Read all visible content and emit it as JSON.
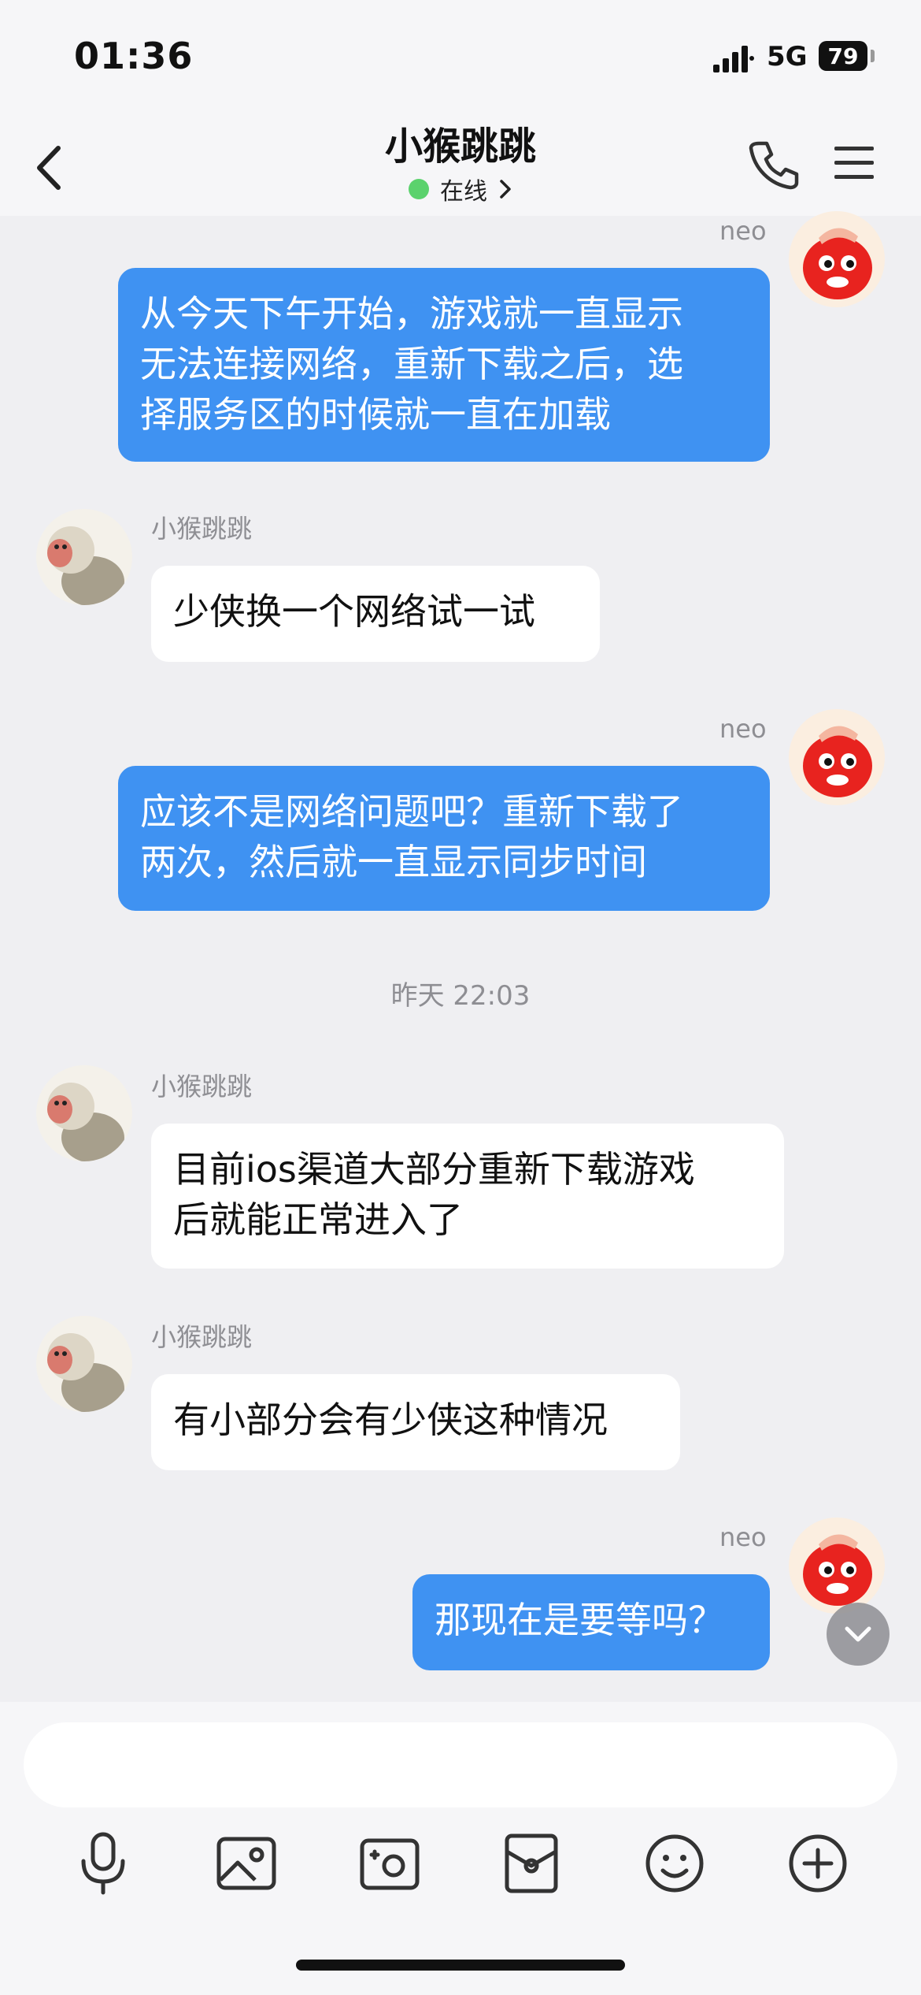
{
  "status_bar": {
    "time": "01:36",
    "network": "5G",
    "battery": "79"
  },
  "header": {
    "title": "小猴跳跳",
    "status": "在线"
  },
  "messages": [
    {
      "sender": "neo",
      "direction": "out",
      "text": "从今天下午开始，游戏就一直显示\n无法连接网络，重新下载之后，选\n择服务区的时候就一直在加载"
    },
    {
      "sender": "小猴跳跳",
      "direction": "in",
      "text": "少侠换一个网络试一试"
    },
    {
      "sender": "neo",
      "direction": "out",
      "text": "应该不是网络问题吧？重新下载了\n两次，然后就一直显示同步时间"
    },
    {
      "sender": "小猴跳跳",
      "direction": "in",
      "text": "目前ios渠道大部分重新下载游戏\n后就能正常进入了"
    },
    {
      "sender": "小猴跳跳",
      "direction": "in",
      "text": "有小部分会有少侠这种情况"
    },
    {
      "sender": "neo",
      "direction": "out",
      "text": "那现在是要等吗？"
    }
  ],
  "timestamp": "昨天 22:03",
  "input": {
    "placeholder": ""
  },
  "toolbar": {
    "icons": [
      "microphone-icon",
      "image-icon",
      "camera-icon",
      "red-packet-icon",
      "emoji-icon",
      "plus-icon"
    ]
  },
  "colors": {
    "outgoing_bubble": "#3f92f2",
    "incoming_bubble": "#ffffff",
    "online_dot": "#5bd26d",
    "neo_avatar": "#e8231f"
  }
}
